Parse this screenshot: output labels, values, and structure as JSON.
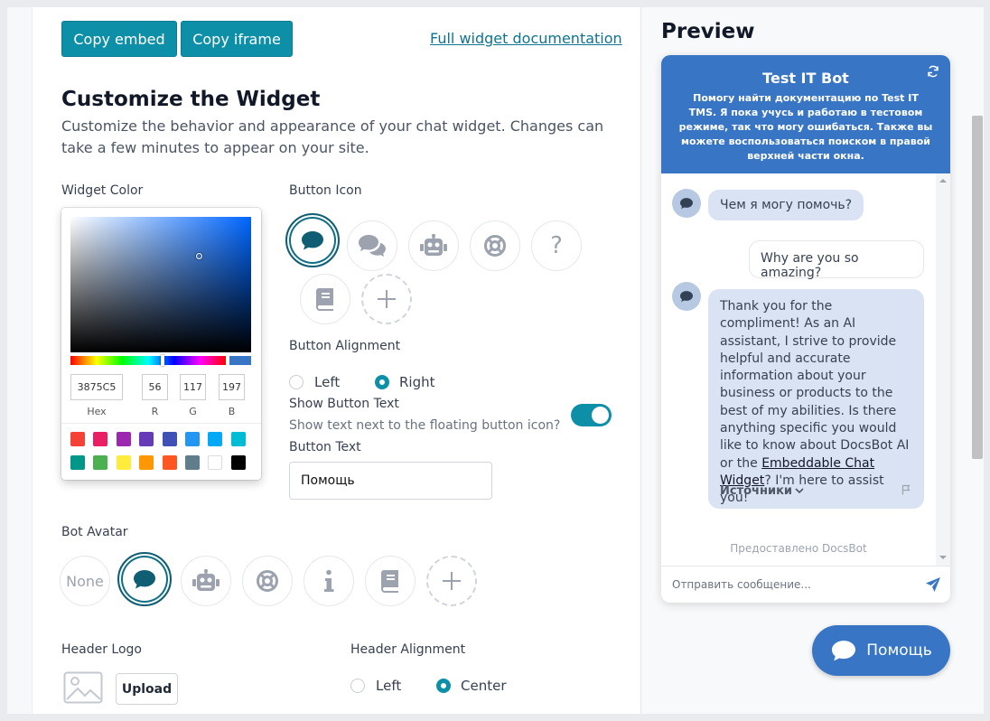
{
  "toolbar": {
    "copy_embed": "Copy embed",
    "copy_iframe": "Copy iframe",
    "docs_link": "Full widget documentation"
  },
  "customize": {
    "title": "Customize the Widget",
    "description": "Customize the behavior and appearance of your chat widget. Changes can take a few minutes to appear on your site."
  },
  "widget_color": {
    "label": "Widget Color",
    "hex": "3875C5",
    "r": "56",
    "g": "117",
    "b": "197",
    "labels": {
      "hex": "Hex",
      "r": "R",
      "g": "G",
      "b": "B"
    },
    "presets": [
      "#f44336",
      "#e91e63",
      "#9c27b0",
      "#673ab7",
      "#3f51b5",
      "#2196f3",
      "#03a9f4",
      "#00bcd4",
      "#009688",
      "#4caf50",
      "#ffeb3b",
      "#ff9800",
      "#ff5722",
      "#607d8b",
      "#ffffff",
      "#000000"
    ]
  },
  "button_icon": {
    "label": "Button Icon",
    "options": [
      "chat-bubble-icon",
      "comments-icon",
      "robot-icon",
      "life-ring-icon",
      "question-icon",
      "book-icon",
      "add-icon"
    ],
    "selected": "chat-bubble-icon"
  },
  "button_alignment": {
    "label": "Button Alignment",
    "left": "Left",
    "right": "Right",
    "selected": "Right"
  },
  "show_button_text": {
    "label": "Show Button Text",
    "help": "Show text next to the floating button icon?",
    "enabled": true
  },
  "button_text": {
    "label": "Button Text",
    "value": "Помощь"
  },
  "bot_avatar": {
    "label": "Bot Avatar",
    "none": "None",
    "options": [
      "none",
      "chat-bubble-icon",
      "robot-icon",
      "life-ring-icon",
      "info-icon",
      "book-icon",
      "add-icon"
    ],
    "selected": "chat-bubble-icon"
  },
  "header_logo": {
    "label": "Header Logo",
    "upload": "Upload"
  },
  "header_alignment": {
    "label": "Header Alignment",
    "left": "Left",
    "center": "Center",
    "selected": "Center"
  },
  "preview": {
    "title": "Preview",
    "bot_name": "Test IT Bot",
    "bot_description": "Помогу найти документацию по Test IT TMS. Я пока учусь и работаю в тестовом режиме, так что могу ошибаться. Также вы можете воспользоваться поиском в правой верхней части окна.",
    "greeting": "Чем я могу помочь?",
    "user_message": "Why are you so amazing?",
    "reply_part1": "Thank you for the compliment! As an AI assistant, I strive to provide helpful and accurate information about your business or products to the best of my abilities. Is there anything specific you would like to know about DocsBot AI or the ",
    "reply_link": "Embeddable Chat Widget",
    "reply_part2": "? I'm here to assist you!",
    "sources": "Источники",
    "powered_by": "Предоставлено DocsBot",
    "input_placeholder": "Отправить сообщение...",
    "fab_label": "Помощь",
    "accent_color": "#3875C5"
  }
}
